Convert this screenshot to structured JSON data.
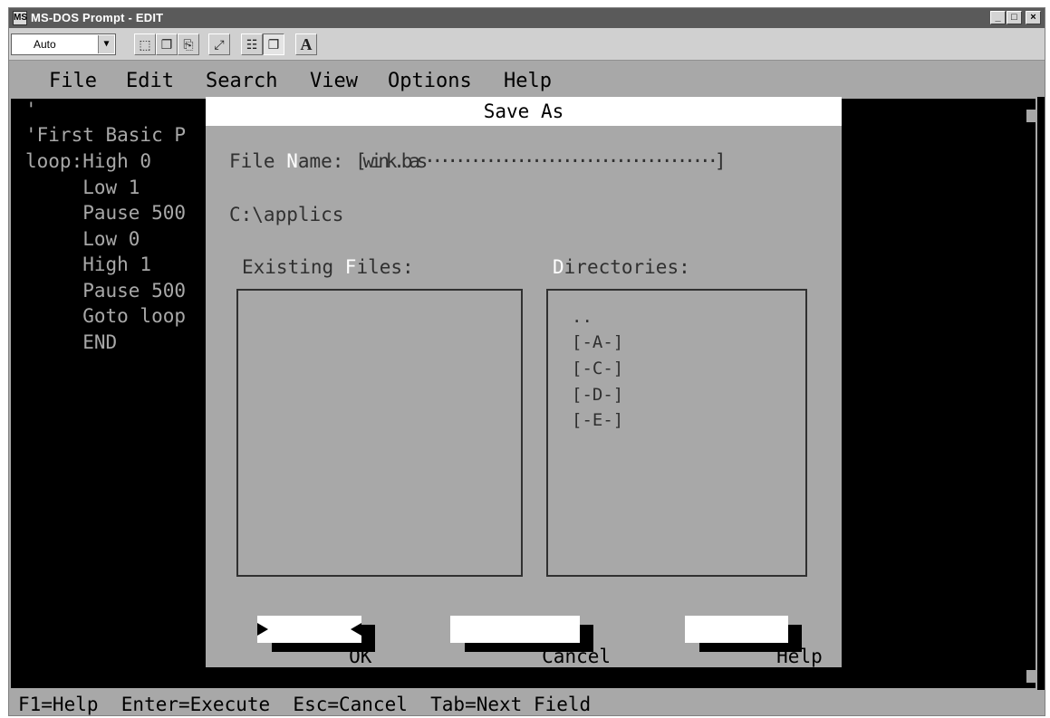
{
  "window": {
    "title": "MS-DOS Prompt - EDIT",
    "app_icon": "MS",
    "controls": {
      "minimize": "_",
      "maximize": "□",
      "close": "×"
    }
  },
  "toolbar": {
    "font_size_value": "Auto",
    "dropdown_arrow": "▼",
    "buttons": [
      {
        "name": "mark-icon",
        "glyph": "⬚"
      },
      {
        "name": "copy-icon",
        "glyph": "❐"
      },
      {
        "name": "paste-icon",
        "glyph": "⎘"
      },
      {
        "name": "fullscreen-icon",
        "glyph": "⤢"
      },
      {
        "name": "properties-icon",
        "glyph": "☷"
      },
      {
        "name": "background-icon",
        "glyph": "❐"
      },
      {
        "name": "font-icon",
        "glyph": "A"
      }
    ]
  },
  "menubar": {
    "items": [
      {
        "label": "File"
      },
      {
        "label": "Edit"
      },
      {
        "label": "Search"
      },
      {
        "label": "View"
      },
      {
        "label": "Options"
      },
      {
        "label": "Help"
      }
    ]
  },
  "editor": {
    "lines": [
      "'",
      "'First Basic P",
      "loop:High 0",
      "     Low 1",
      "     Pause 500",
      "     Low 0",
      "     High 1",
      "     Pause 500",
      "     Goto loop",
      "     END"
    ]
  },
  "dialog": {
    "title": "Save As",
    "file_name_label_pre": "File ",
    "file_name_label_hotkey": "N",
    "file_name_label_post": "ame: ",
    "file_name_value": "[wink.bas······································]",
    "current_path": "C:\\applics",
    "files_label_pre": "Existing ",
    "files_label_hotkey": "F",
    "files_label_post": "iles:",
    "dirs_label_hotkey": "D",
    "dirs_label_post": "irectories:",
    "directories": [
      "..",
      "[-A-]",
      "[-C-]",
      "[-D-]",
      "[-E-]"
    ],
    "ok_label": "OK",
    "cancel_label": "Cancel",
    "help_label": "Help"
  },
  "statusbar": {
    "text": "F1=Help  Enter=Execute  Esc=Cancel  Tab=Next Field"
  }
}
